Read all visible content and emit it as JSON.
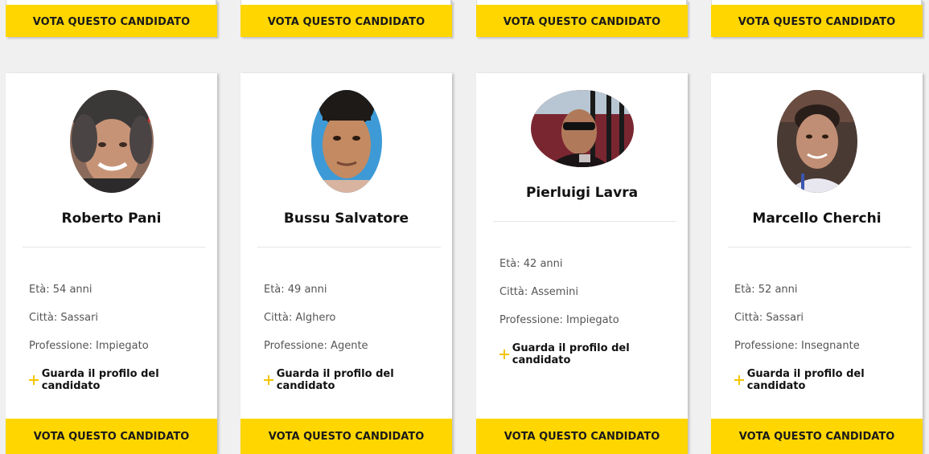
{
  "top_row": {
    "buttons": [
      {
        "label": "VOTA QUESTO CANDIDATO"
      },
      {
        "label": "VOTA QUESTO CANDIDATO"
      },
      {
        "label": "VOTA QUESTO CANDIDATO"
      },
      {
        "label": "VOTA QUESTO CANDIDATO"
      }
    ]
  },
  "candidates": [
    {
      "name": "Roberto Pani",
      "age": "Età: 54 anni",
      "city": "Città: Sassari",
      "profession": "Professione: Impiegato",
      "profile_link": "Guarda il profilo del candidato",
      "vote_label": "VOTA QUESTO CANDIDATO"
    },
    {
      "name": "Bussu Salvatore",
      "age": "Età: 49 anni",
      "city": "Città: Alghero",
      "profession": "Professione: Agente",
      "profile_link": "Guarda il profilo del candidato",
      "vote_label": "VOTA QUESTO CANDIDATO"
    },
    {
      "name": "Pierluigi Lavra",
      "age": "Età: 42 anni",
      "city": "Città: Assemini",
      "profession": "Professione: Impiegato",
      "profile_link": "Guarda il profilo del candidato",
      "vote_label": "VOTA QUESTO CANDIDATO"
    },
    {
      "name": "Marcello Cherchi",
      "age": "Età: 52 anni",
      "city": "Città: Sassari",
      "profession": "Professione: Insegnante",
      "profile_link": "Guarda il profilo del candidato",
      "vote_label": "VOTA QUESTO CANDIDATO"
    }
  ],
  "icons": {
    "profile_link_icon": "plus-icon"
  },
  "colors": {
    "accent": "#ffd600",
    "background": "#f0f0f0",
    "card": "#ffffff"
  }
}
